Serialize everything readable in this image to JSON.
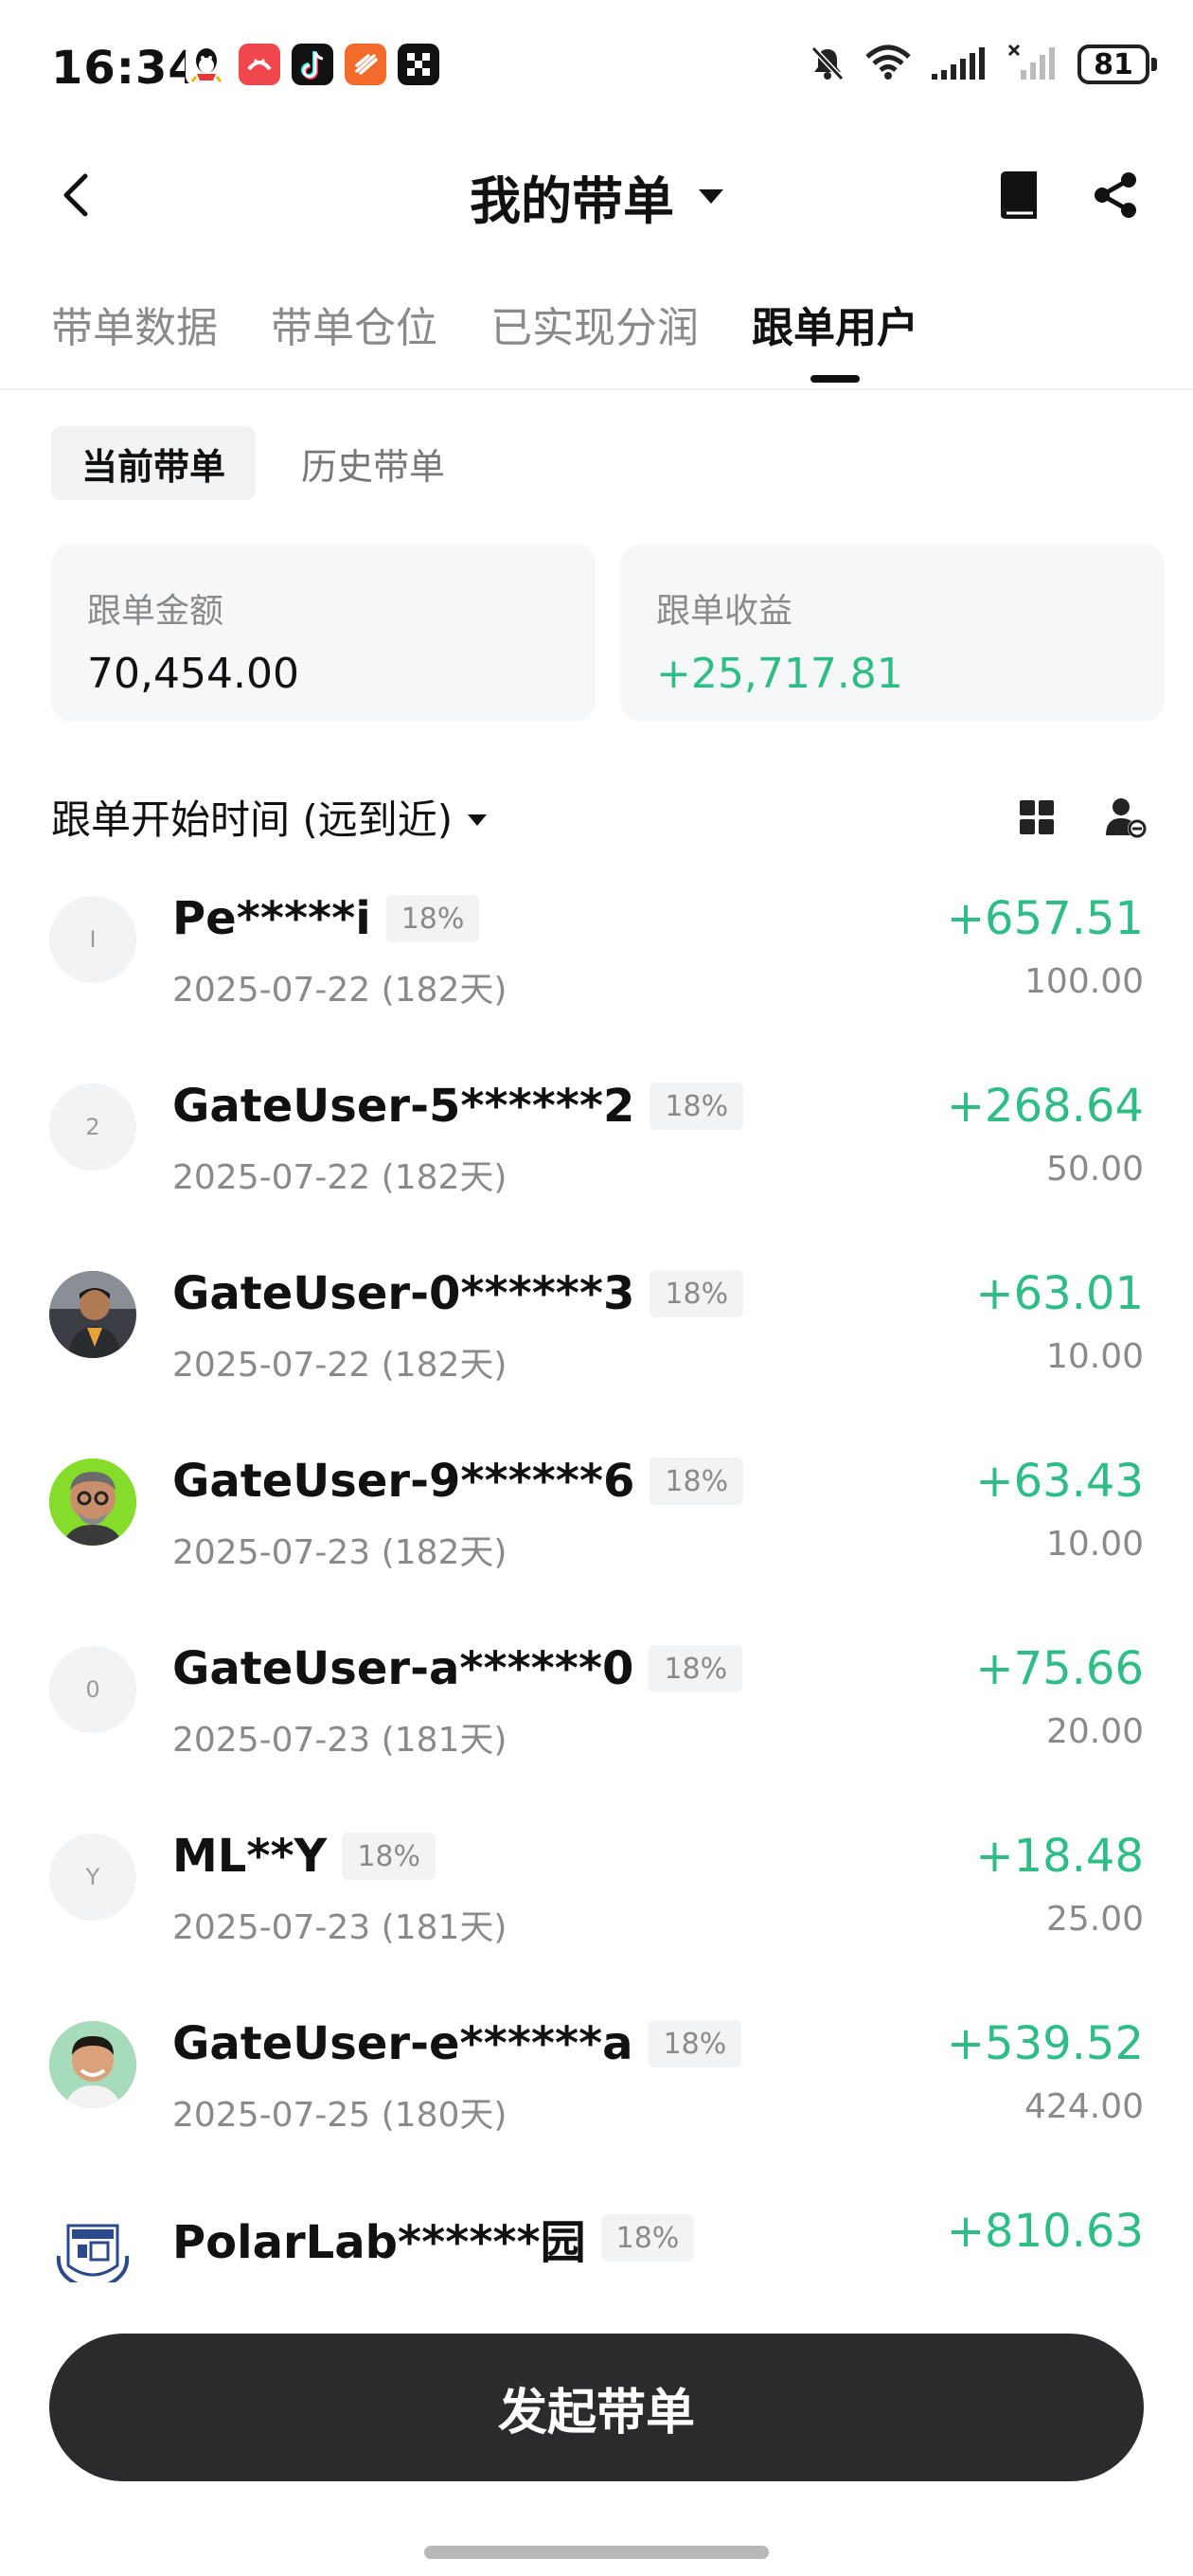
{
  "status_bar": {
    "time": "16:34",
    "battery": "81",
    "app_icons": [
      {
        "icon": "qq-icon",
        "color": "#ffffff"
      },
      {
        "icon": "red-app-icon",
        "color": "#f0474f"
      },
      {
        "icon": "tiktok-icon",
        "color": "#111111"
      },
      {
        "icon": "orange-app-icon",
        "color": "#f36b2a"
      },
      {
        "icon": "okx-icon",
        "color": "#111111"
      }
    ],
    "indicators": [
      "mute-icon",
      "wifi-icon",
      "signal-icon",
      "signal-off-icon"
    ]
  },
  "header": {
    "title": "我的带单",
    "icons": {
      "back": "chevron-left-icon",
      "book": "book-icon",
      "share": "share-icon"
    }
  },
  "tabs": [
    {
      "label": "带单数据",
      "active": false
    },
    {
      "label": "带单仓位",
      "active": false
    },
    {
      "label": "已实现分润",
      "active": false
    },
    {
      "label": "跟单用户",
      "active": true
    }
  ],
  "subtabs": [
    {
      "label": "当前带单",
      "active": true
    },
    {
      "label": "历史带单",
      "active": false
    }
  ],
  "summary": {
    "amount_label": "跟单金额",
    "amount_value": "70,454.00",
    "profit_label": "跟单收益",
    "profit_value": "+25,717.81"
  },
  "sort": {
    "label": "跟单开始时间 (远到近)",
    "icons": {
      "grid": "grid-icon",
      "remove_user": "user-remove-icon"
    }
  },
  "followers": [
    {
      "initial": "I",
      "name": "Pe*****i",
      "share": "18%",
      "date": "2025-07-22 (182天)",
      "profit": "+657.51",
      "amount": "100.00",
      "avatar": "letter"
    },
    {
      "initial": "2",
      "name": "GateUser-5******2",
      "share": "18%",
      "date": "2025-07-22 (182天)",
      "profit": "+268.64",
      "amount": "50.00",
      "avatar": "letter"
    },
    {
      "initial": "",
      "name": "GateUser-0******3",
      "share": "18%",
      "date": "2025-07-22 (182天)",
      "profit": "+63.01",
      "amount": "10.00",
      "avatar": "photo-man-jacket"
    },
    {
      "initial": "",
      "name": "GateUser-9******6",
      "share": "18%",
      "date": "2025-07-23 (182天)",
      "profit": "+63.43",
      "amount": "10.00",
      "avatar": "photo-man-glasses"
    },
    {
      "initial": "0",
      "name": "GateUser-a******0",
      "share": "18%",
      "date": "2025-07-23 (181天)",
      "profit": "+75.66",
      "amount": "20.00",
      "avatar": "letter"
    },
    {
      "initial": "Y",
      "name": "ML**Y",
      "share": "18%",
      "date": "2025-07-23 (181天)",
      "profit": "+18.48",
      "amount": "25.00",
      "avatar": "letter"
    },
    {
      "initial": "",
      "name": "GateUser-e******a",
      "share": "18%",
      "date": "2025-07-25 (180天)",
      "profit": "+539.52",
      "amount": "424.00",
      "avatar": "photo-man-smile"
    },
    {
      "initial": "",
      "name": "PolarLab******园",
      "share": "18%",
      "date": "",
      "profit": "+810.63",
      "amount": "",
      "avatar": "logo-polarlab"
    }
  ],
  "cta": {
    "label": "发起带单"
  },
  "colors": {
    "positive": "#2ebd85",
    "cta_bg": "#2b2b2d",
    "muted": "#8a8a8a"
  }
}
